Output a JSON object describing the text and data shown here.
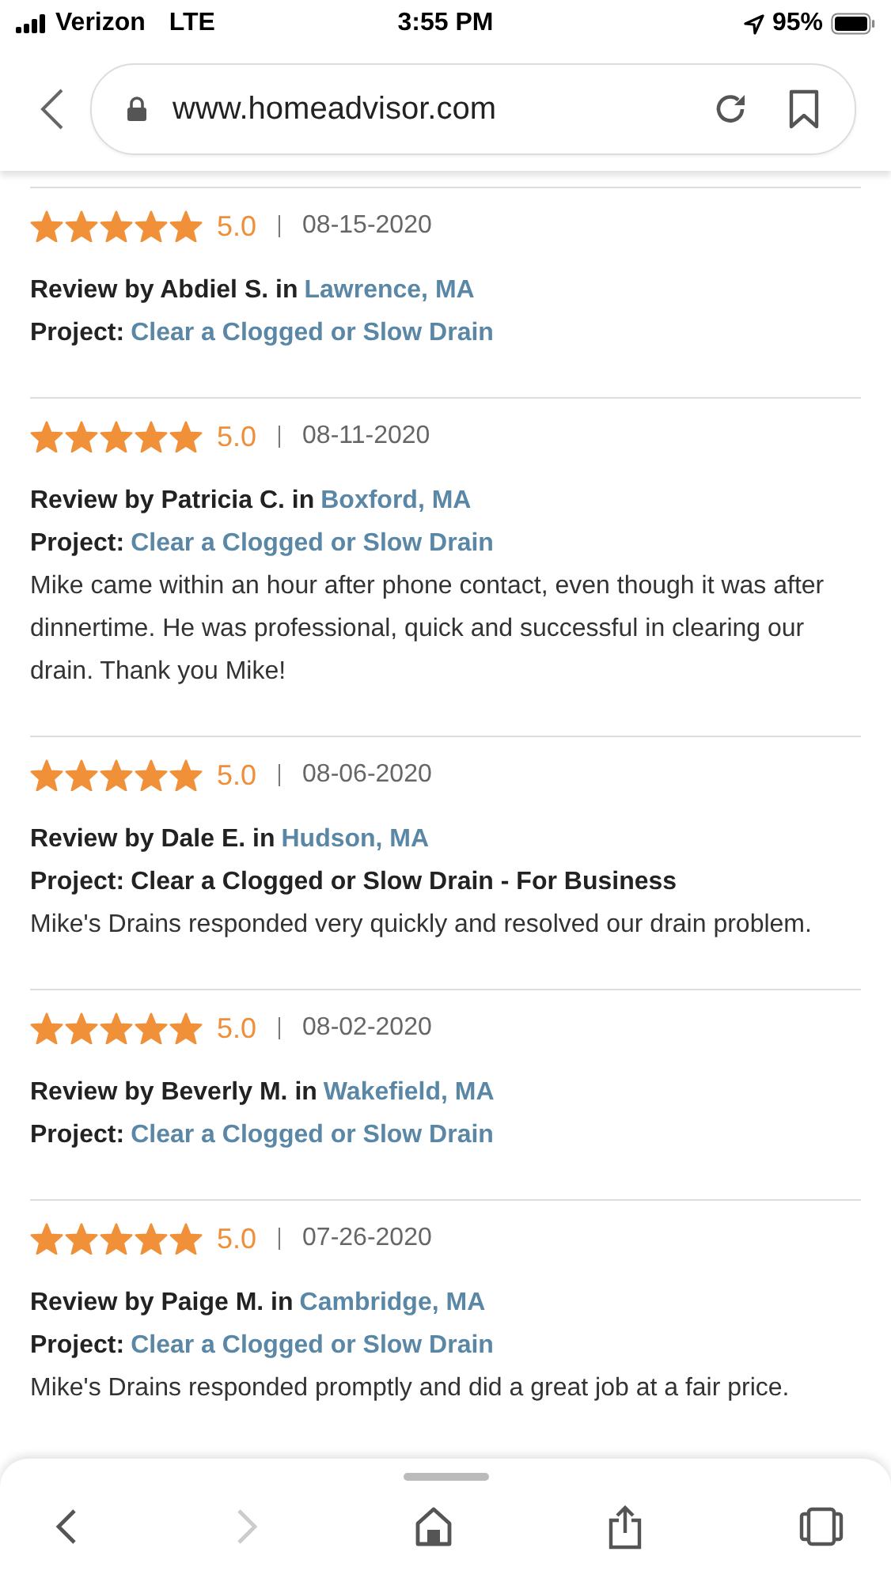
{
  "status_bar": {
    "carrier": "Verizon",
    "network": "LTE",
    "time": "3:55 PM",
    "battery": "95%"
  },
  "browser": {
    "url": "www.homeadvisor.com"
  },
  "reviews": [
    {
      "stars": 5,
      "rating": "5.0",
      "date": "08-15-2020",
      "by": "Review by Abdiel S. in",
      "location": "Lawrence, MA",
      "project_label": "Project:",
      "project": "Clear a Clogged or Slow Drain",
      "project_link": true
    },
    {
      "stars": 5,
      "rating": "5.0",
      "date": "08-11-2020",
      "by": "Review by Patricia C. in",
      "location": "Boxford, MA",
      "project_label": "Project:",
      "project": "Clear a Clogged or Slow Drain",
      "project_link": true,
      "text": "Mike came within an hour after phone contact, even though it was after dinnertime. He was professional, quick and successful in clearing our drain. Thank you Mike!"
    },
    {
      "stars": 5,
      "rating": "5.0",
      "date": "08-06-2020",
      "by": "Review by Dale E. in",
      "location": "Hudson, MA",
      "project_label": "Project:",
      "project": "Clear a Clogged or Slow Drain - For Business",
      "project_link": false,
      "text": "Mike's Drains responded very quickly and resolved our drain problem."
    },
    {
      "stars": 5,
      "rating": "5.0",
      "date": "08-02-2020",
      "by": "Review by Beverly M. in",
      "location": "Wakefield, MA",
      "project_label": "Project:",
      "project": "Clear a Clogged or Slow Drain",
      "project_link": true
    },
    {
      "stars": 5,
      "rating": "5.0",
      "date": "07-26-2020",
      "by": "Review by Paige M. in",
      "location": "Cambridge, MA",
      "project_label": "Project:",
      "project": "Clear a Clogged or Slow Drain",
      "project_link": true,
      "text": "Mike's Drains responded promptly and did a great job at a fair price."
    }
  ],
  "toolbar": {
    "back_disabled": false,
    "forward_disabled": true
  }
}
